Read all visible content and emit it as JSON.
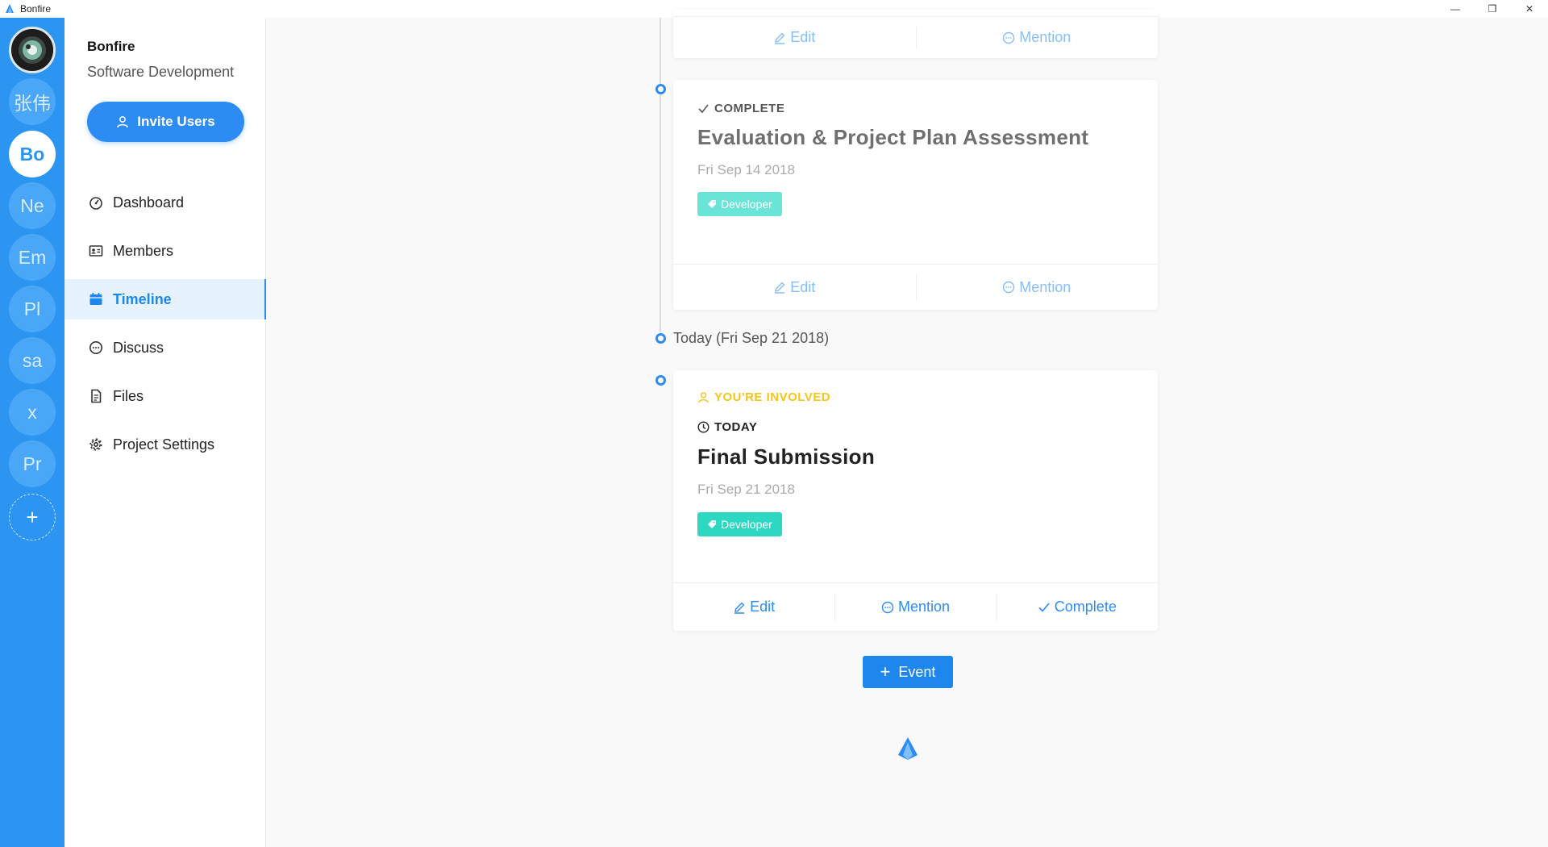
{
  "window": {
    "title": "Bonfire",
    "controls": {
      "minimize": "—",
      "restore": "❐",
      "close": "✕"
    }
  },
  "rail": {
    "projects": [
      {
        "label": "",
        "kind": "avatar"
      },
      {
        "label": "张伟"
      },
      {
        "label": "Bo",
        "active": true
      },
      {
        "label": "Ne"
      },
      {
        "label": "Em"
      },
      {
        "label": "Pl"
      },
      {
        "label": "sa"
      },
      {
        "label": "x"
      },
      {
        "label": "Pr"
      }
    ],
    "add_label": "+"
  },
  "sidebar": {
    "org_name": "Bonfire",
    "org_subtitle": "Software Development",
    "invite_label": "Invite Users",
    "nav": [
      {
        "label": "Dashboard",
        "icon": "dashboard-icon"
      },
      {
        "label": "Members",
        "icon": "members-icon"
      },
      {
        "label": "Timeline",
        "icon": "calendar-icon",
        "active": true
      },
      {
        "label": "Discuss",
        "icon": "chat-icon"
      },
      {
        "label": "Files",
        "icon": "file-icon"
      },
      {
        "label": "Project Settings",
        "icon": "gear-icon"
      }
    ]
  },
  "timeline": {
    "today_label": "Today (Fri Sep 21 2018)",
    "top_card_actions": {
      "edit": "Edit",
      "mention": "Mention"
    },
    "complete_card": {
      "status": "COMPLETE",
      "title": "Evaluation & Project Plan Assessment",
      "date": "Fri Sep 14 2018",
      "tag": "Developer",
      "actions": {
        "edit": "Edit",
        "mention": "Mention"
      }
    },
    "today_card": {
      "involved": "YOU'RE INVOLVED",
      "status": "TODAY",
      "title": "Final Submission",
      "date": "Fri Sep 21 2018",
      "tag": "Developer",
      "actions": {
        "edit": "Edit",
        "mention": "Mention",
        "complete": "Complete"
      }
    },
    "event_button": "Event"
  },
  "colors": {
    "accent": "#2c8cf4",
    "rail": "#2c95f2",
    "tag": "#2dd8c3",
    "tag_faded": "#6ae4d6",
    "involved": "#f5c518"
  }
}
